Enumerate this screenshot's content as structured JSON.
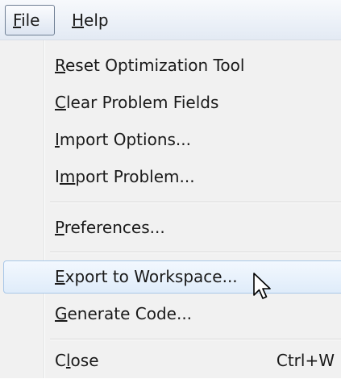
{
  "menubar": {
    "file": {
      "label": "File",
      "accel": "F",
      "rest": "ile"
    },
    "help": {
      "label": "Help",
      "accel": "H",
      "rest": "elp"
    }
  },
  "menu": {
    "items": [
      {
        "label": "Reset Optimization Tool",
        "pre": "",
        "accel": "R",
        "post": "eset Optimization Tool",
        "shortcut": ""
      },
      {
        "label": "Clear Problem Fields",
        "pre": "",
        "accel": "C",
        "post": "lear Problem Fields",
        "shortcut": ""
      },
      {
        "label": "Import Options...",
        "pre": "",
        "accel": "I",
        "post": "mport Options...",
        "shortcut": ""
      },
      {
        "label": "Import Problem...",
        "pre": "I",
        "accel": "m",
        "post": "port Problem...",
        "shortcut": ""
      },
      {
        "label": "Preferences...",
        "pre": "",
        "accel": "P",
        "post": "references...",
        "shortcut": ""
      },
      {
        "label": "Export to Workspace...",
        "pre": "",
        "accel": "E",
        "post": "xport to Workspace...",
        "shortcut": ""
      },
      {
        "label": "Generate Code...",
        "pre": "",
        "accel": "G",
        "post": "enerate Code...",
        "shortcut": ""
      },
      {
        "label": "Close",
        "pre": "C",
        "accel": "l",
        "post": "ose",
        "shortcut": "Ctrl+W"
      }
    ],
    "highlighted_index": 5
  },
  "colors": {
    "highlight_border": "#aac8e8",
    "highlight_fill": "#dfecfa",
    "menu_background": "#f1f1f1"
  },
  "cursor": {
    "icon": "arrow-pointer-icon"
  }
}
